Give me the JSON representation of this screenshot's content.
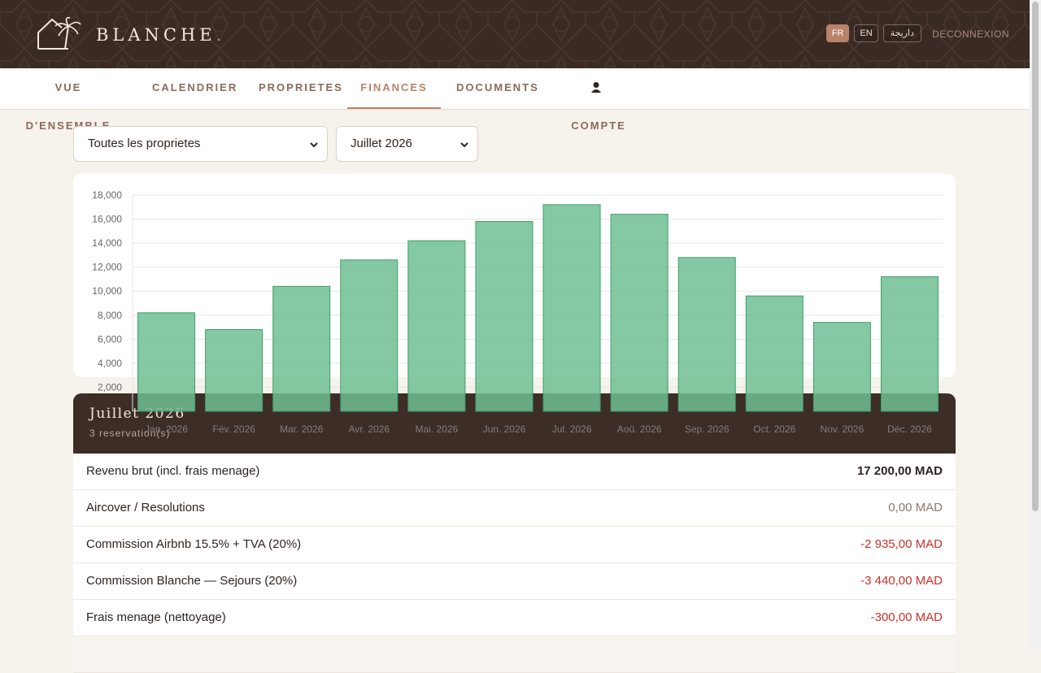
{
  "brand": {
    "name": "BLANCHE",
    "dot": "."
  },
  "languages": [
    {
      "label": "FR",
      "active": true
    },
    {
      "label": "EN",
      "active": false
    },
    {
      "label": "داريجة",
      "active": false
    }
  ],
  "logout_label": "DECONNEXION",
  "nav": {
    "overview": "VUE D'ENSEMBLE",
    "calendar": "CALENDRIER",
    "properties": "PROPRIETES",
    "finances": "FINANCES",
    "documents": "DOCUMENTS",
    "account": "COMPTE"
  },
  "filters": {
    "property": "Toutes les proprietes",
    "month": "Juillet 2026"
  },
  "chart_data": {
    "type": "bar",
    "categories": [
      "Jan. 2026",
      "Fév. 2026",
      "Mar. 2026",
      "Avr. 2026",
      "Mai. 2026",
      "Jun. 2026",
      "Jul. 2026",
      "Aoû. 2026",
      "Sep. 2026",
      "Oct. 2026",
      "Nov. 2026",
      "Déc. 2026"
    ],
    "values": [
      8200,
      6800,
      10400,
      12600,
      14200,
      15800,
      17200,
      16400,
      12800,
      9600,
      7400,
      11200
    ],
    "yticks": [
      "2,000",
      "4,000",
      "6,000",
      "8,000",
      "10,000",
      "12,000",
      "14,000",
      "16,000",
      "18,000"
    ],
    "ylim": [
      0,
      18000
    ],
    "grid": true,
    "bar_color": "#6fbf93"
  },
  "summary": {
    "title": "Juillet 2026",
    "subtitle": "3 reservation(s)"
  },
  "rows": [
    {
      "label": "Revenu brut (incl. frais menage)",
      "amount": "17 200,00 MAD",
      "kind": "pos"
    },
    {
      "label": "Aircover / Resolutions",
      "amount": "0,00 MAD",
      "kind": "zero"
    },
    {
      "label": "Commission Airbnb 15.5% + TVA (20%)",
      "amount": "-2 935,00 MAD",
      "kind": "neg"
    },
    {
      "label": "Commission Blanche — Sejours (20%)",
      "amount": "-3 440,00 MAD",
      "kind": "neg"
    },
    {
      "label": "Frais menage (nettoyage)",
      "amount": "-300,00 MAD",
      "kind": "neg"
    }
  ]
}
